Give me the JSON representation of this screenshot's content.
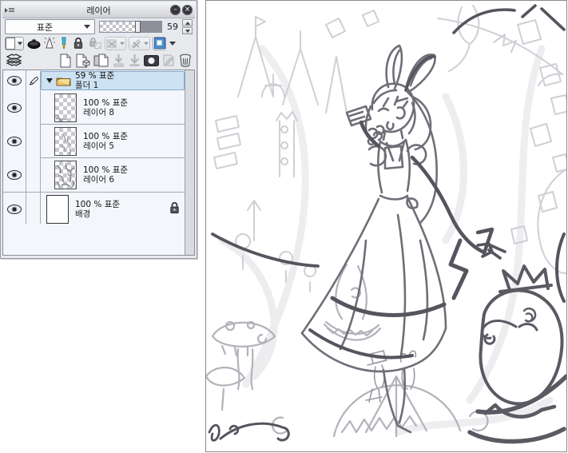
{
  "window": {
    "title": "레이어",
    "minimize_glyph": "–",
    "close_glyph": "×"
  },
  "blend": {
    "mode": "표준",
    "opacity_value": "59"
  },
  "icons": {
    "titlebar": [
      "panel-menu-icon",
      "minimize-icon",
      "close-icon"
    ],
    "tool_row": [
      "paper-color-swatch",
      "ink-icon",
      "airbrush-icon",
      "pen-icon",
      "lock-icon",
      "lock-alpha-icon",
      "clip-mask-off-icon",
      "stencil-off-icon",
      "layer-color-swatch"
    ],
    "ops_row": [
      "layers-stack-icon",
      "new-layer-icon",
      "new-layer-set-icon",
      "duplicate-layer-icon",
      "transfer-down-icon",
      "merge-down-icon",
      "layer-mask-icon",
      "stencil-icon",
      "delete-layer-icon"
    ]
  },
  "layers": [
    {
      "info": "59 % 표준",
      "name": "폴더 1",
      "type": "folder",
      "selected": true,
      "visible": true,
      "editing": true
    },
    {
      "info": "100 % 표준",
      "name": "레이어 8",
      "type": "layer",
      "selected": false,
      "visible": true
    },
    {
      "info": "100 % 표준",
      "name": "레이어 5",
      "type": "layer",
      "selected": false,
      "visible": true
    },
    {
      "info": "100 % 표준",
      "name": "레이어 6",
      "type": "layer",
      "selected": false,
      "visible": true
    },
    {
      "info": "100 % 표준",
      "name": "배경",
      "type": "background",
      "selected": false,
      "visible": true,
      "locked": true
    }
  ],
  "colors": {
    "selection_blue": "#cde2f2",
    "accent_blue": "#4f8fd4",
    "panel_bg": "#e7e9ed",
    "list_bg": "#f3f6fa",
    "canvas_border": "#8a8a8a",
    "pen_cyan": "#3cc2de",
    "pen_yellow": "#f0d33c",
    "folder_gold": "#ecc668"
  }
}
